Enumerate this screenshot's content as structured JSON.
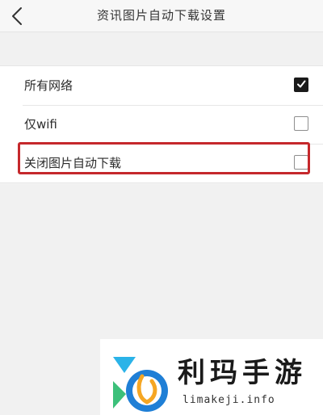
{
  "header": {
    "title": "资讯图片自动下载设置",
    "back_icon": "chevron-left-icon"
  },
  "options": [
    {
      "label": "所有网络",
      "checked": true
    },
    {
      "label": "仅wifi",
      "checked": false
    },
    {
      "label": "关闭图片自动下载",
      "checked": false,
      "highlighted": true
    }
  ],
  "colors": {
    "highlight": "#c5282c",
    "checkbox_checked": "#1a1a1a"
  },
  "watermark": {
    "brand": "利玛手游",
    "url": "limakeji.info"
  }
}
